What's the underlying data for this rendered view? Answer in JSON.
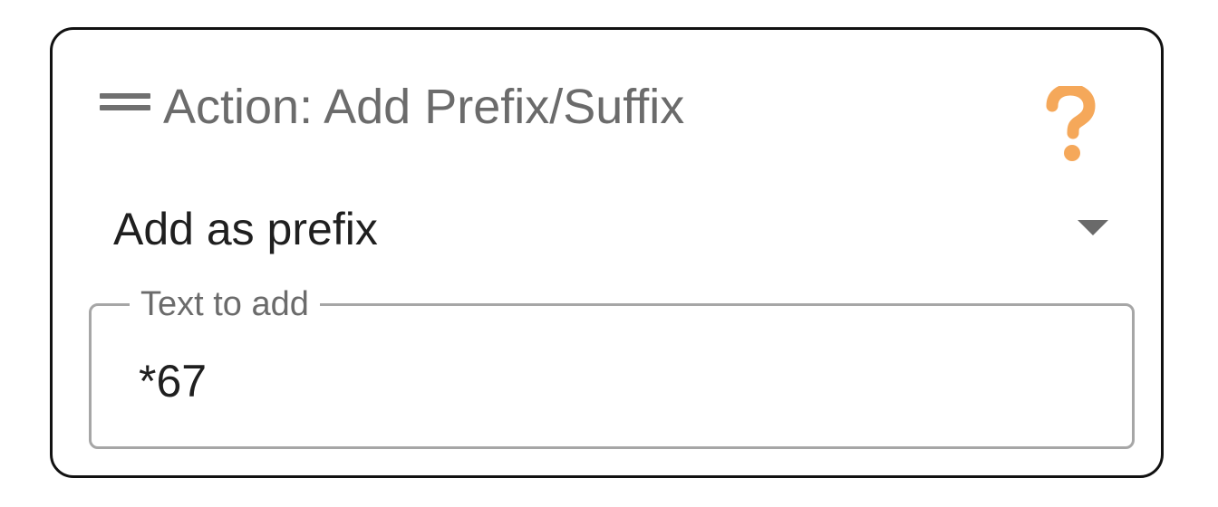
{
  "action_card": {
    "title": "Action: Add Prefix/Suffix",
    "drag_handle_icon": "drag-handle-icon",
    "help_icon": "question-mark-icon",
    "help_icon_color": "#f5a85a",
    "mode_select": {
      "selected_value": "Add as prefix",
      "arrow_icon": "dropdown-arrow-icon"
    },
    "text_field": {
      "label": "Text to add",
      "value": "*67"
    }
  }
}
